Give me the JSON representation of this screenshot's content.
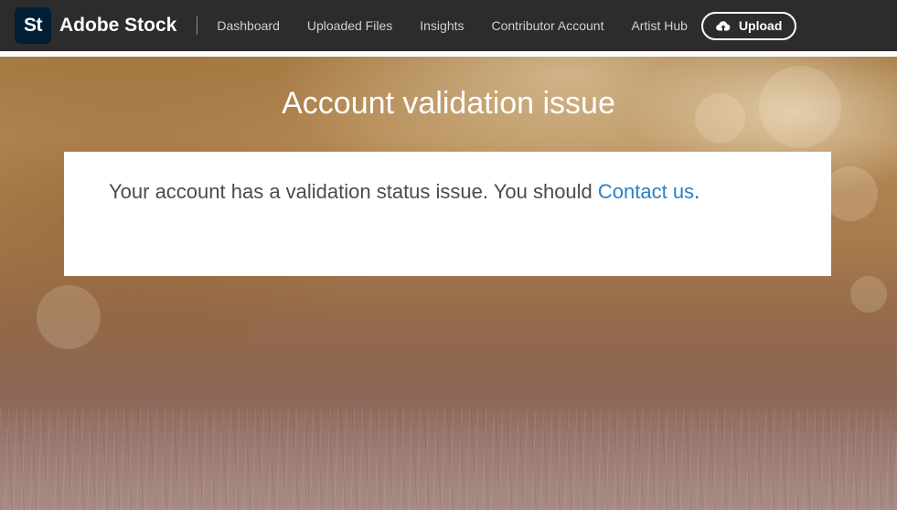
{
  "header": {
    "logo_text": "St",
    "brand": "Adobe Stock",
    "nav": [
      {
        "label": "Dashboard"
      },
      {
        "label": "Uploaded Files"
      },
      {
        "label": "Insights"
      },
      {
        "label": "Contributor Account"
      },
      {
        "label": "Artist Hub"
      }
    ],
    "upload": {
      "label": "Upload",
      "icon": "cloud-upload-icon"
    }
  },
  "main": {
    "title": "Account validation issue",
    "message_prefix": "Your account has a validation status issue. You should ",
    "link_label": "Contact us",
    "message_suffix": "."
  },
  "colors": {
    "topbar": "#2c2c2c",
    "logo_badge": "#001e36",
    "link": "#2d7fc3",
    "message_text": "#4b4b4b"
  }
}
